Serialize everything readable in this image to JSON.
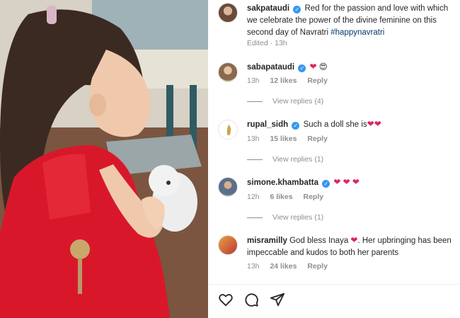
{
  "post": {
    "author": "sakpataudi",
    "caption": "Red for the passion and love with which we celebrate the power of the divine feminine on this second day of Navratri",
    "hashtag": "#happynavratri",
    "edited": "Edited · 13h"
  },
  "comments": [
    {
      "user": "sabapataudi",
      "verified": true,
      "text": "",
      "emojis": [
        "❤",
        "😍"
      ],
      "time": "13h",
      "likes": "12 likes",
      "reply": "Reply",
      "view_replies": "View replies (4)"
    },
    {
      "user": "rupal_sidh",
      "verified": true,
      "text": "Such a doll she is",
      "emojis": [
        "❤",
        "❤"
      ],
      "time": "13h",
      "likes": "15 likes",
      "reply": "Reply",
      "view_replies": "View replies (1)"
    },
    {
      "user": "simone.khambatta",
      "verified": true,
      "text": "",
      "emojis": [
        "❤",
        "❤",
        "❤"
      ],
      "time": "12h",
      "likes": "6 likes",
      "reply": "Reply",
      "view_replies": "View replies (1)"
    },
    {
      "user": "misramilly",
      "verified": false,
      "text_before": "God bless Inaya",
      "emojis": [
        "❤"
      ],
      "text_after": ". Her upbringing has been impeccable and kudos to both her parents",
      "time": "13h",
      "likes": "24 likes",
      "reply": "Reply"
    }
  ],
  "actions": {
    "like_icon": "heart-outline-icon",
    "comment_icon": "comment-bubble-icon",
    "share_icon": "paper-plane-icon"
  },
  "colors": {
    "verified": "#3897f0",
    "heart": "#e0245e",
    "meta": "#8e8e8e",
    "hashtag": "#00376b"
  }
}
